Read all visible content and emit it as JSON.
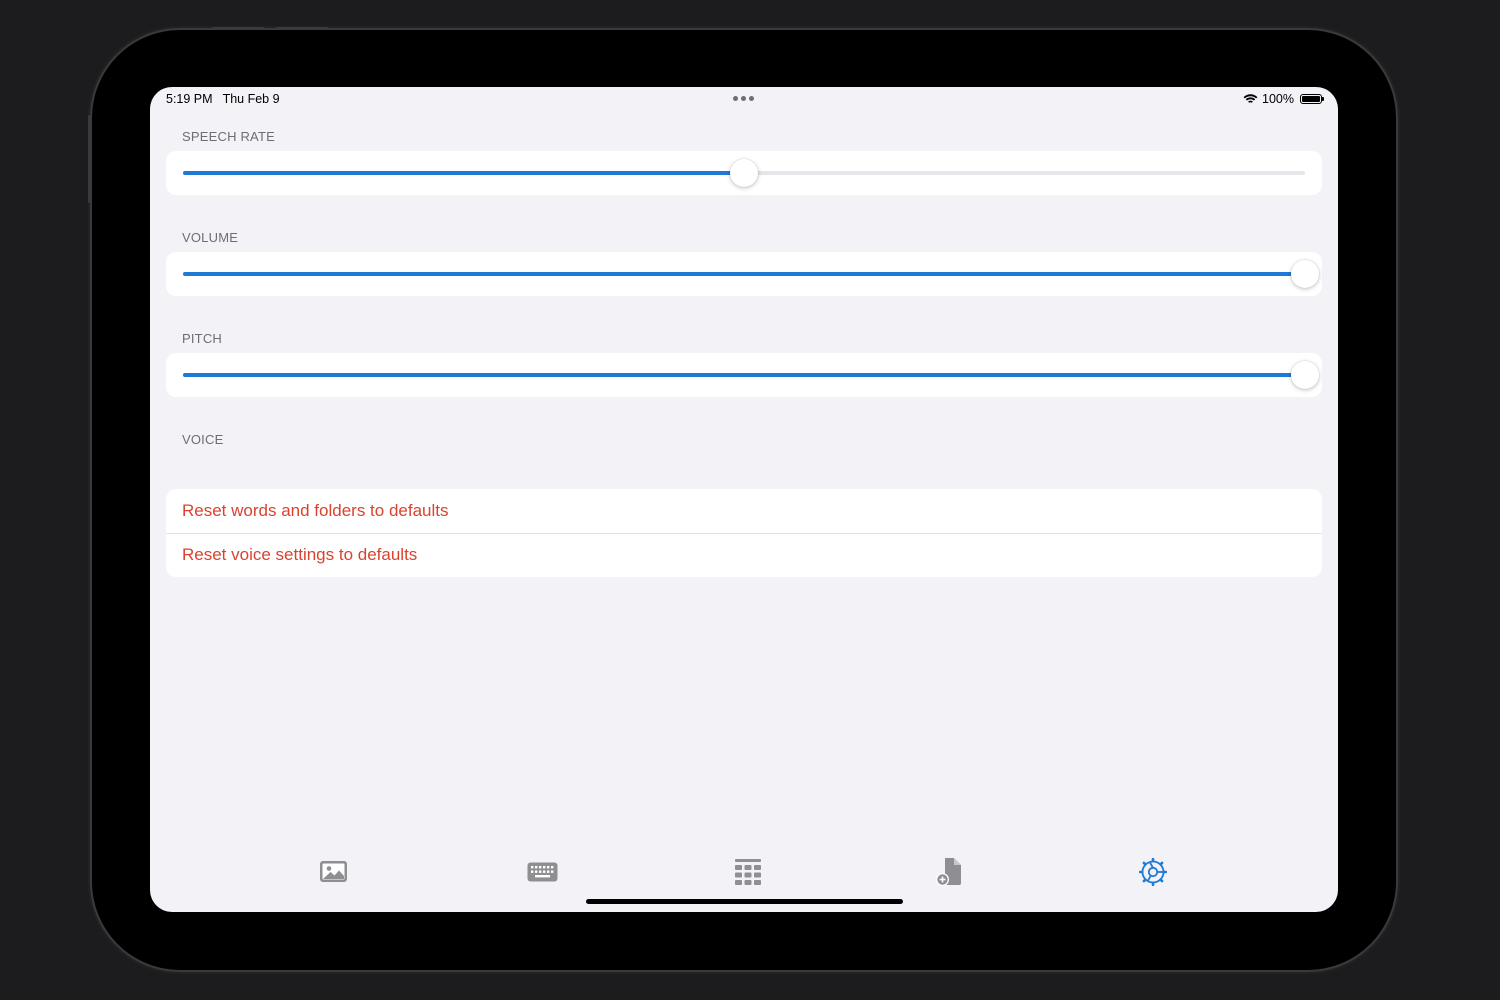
{
  "status_bar": {
    "time": "5:19 PM",
    "date": "Thu Feb 9",
    "battery": "100%"
  },
  "settings": {
    "speech_rate": {
      "label": "SPEECH RATE",
      "value": 0.5
    },
    "volume": {
      "label": "VOLUME",
      "value": 1.0
    },
    "pitch": {
      "label": "PITCH",
      "value": 1.0
    },
    "voice": {
      "label": "VOICE"
    },
    "actions": [
      {
        "label": "Reset words and folders to defaults"
      },
      {
        "label": "Reset voice settings to defaults"
      }
    ]
  },
  "tabbar": {
    "tabs": [
      {
        "icon": "photo-icon",
        "selected": false
      },
      {
        "icon": "keyboard-icon",
        "selected": false
      },
      {
        "icon": "grid-icon",
        "selected": false
      },
      {
        "icon": "document-add-icon",
        "selected": false
      },
      {
        "icon": "gear-icon",
        "selected": true
      }
    ],
    "selected_color": "#1f7ad6",
    "unselected_color": "#8e8e93"
  },
  "colors": {
    "accent": "#1f7ad6",
    "destructive": "#d9432f"
  }
}
